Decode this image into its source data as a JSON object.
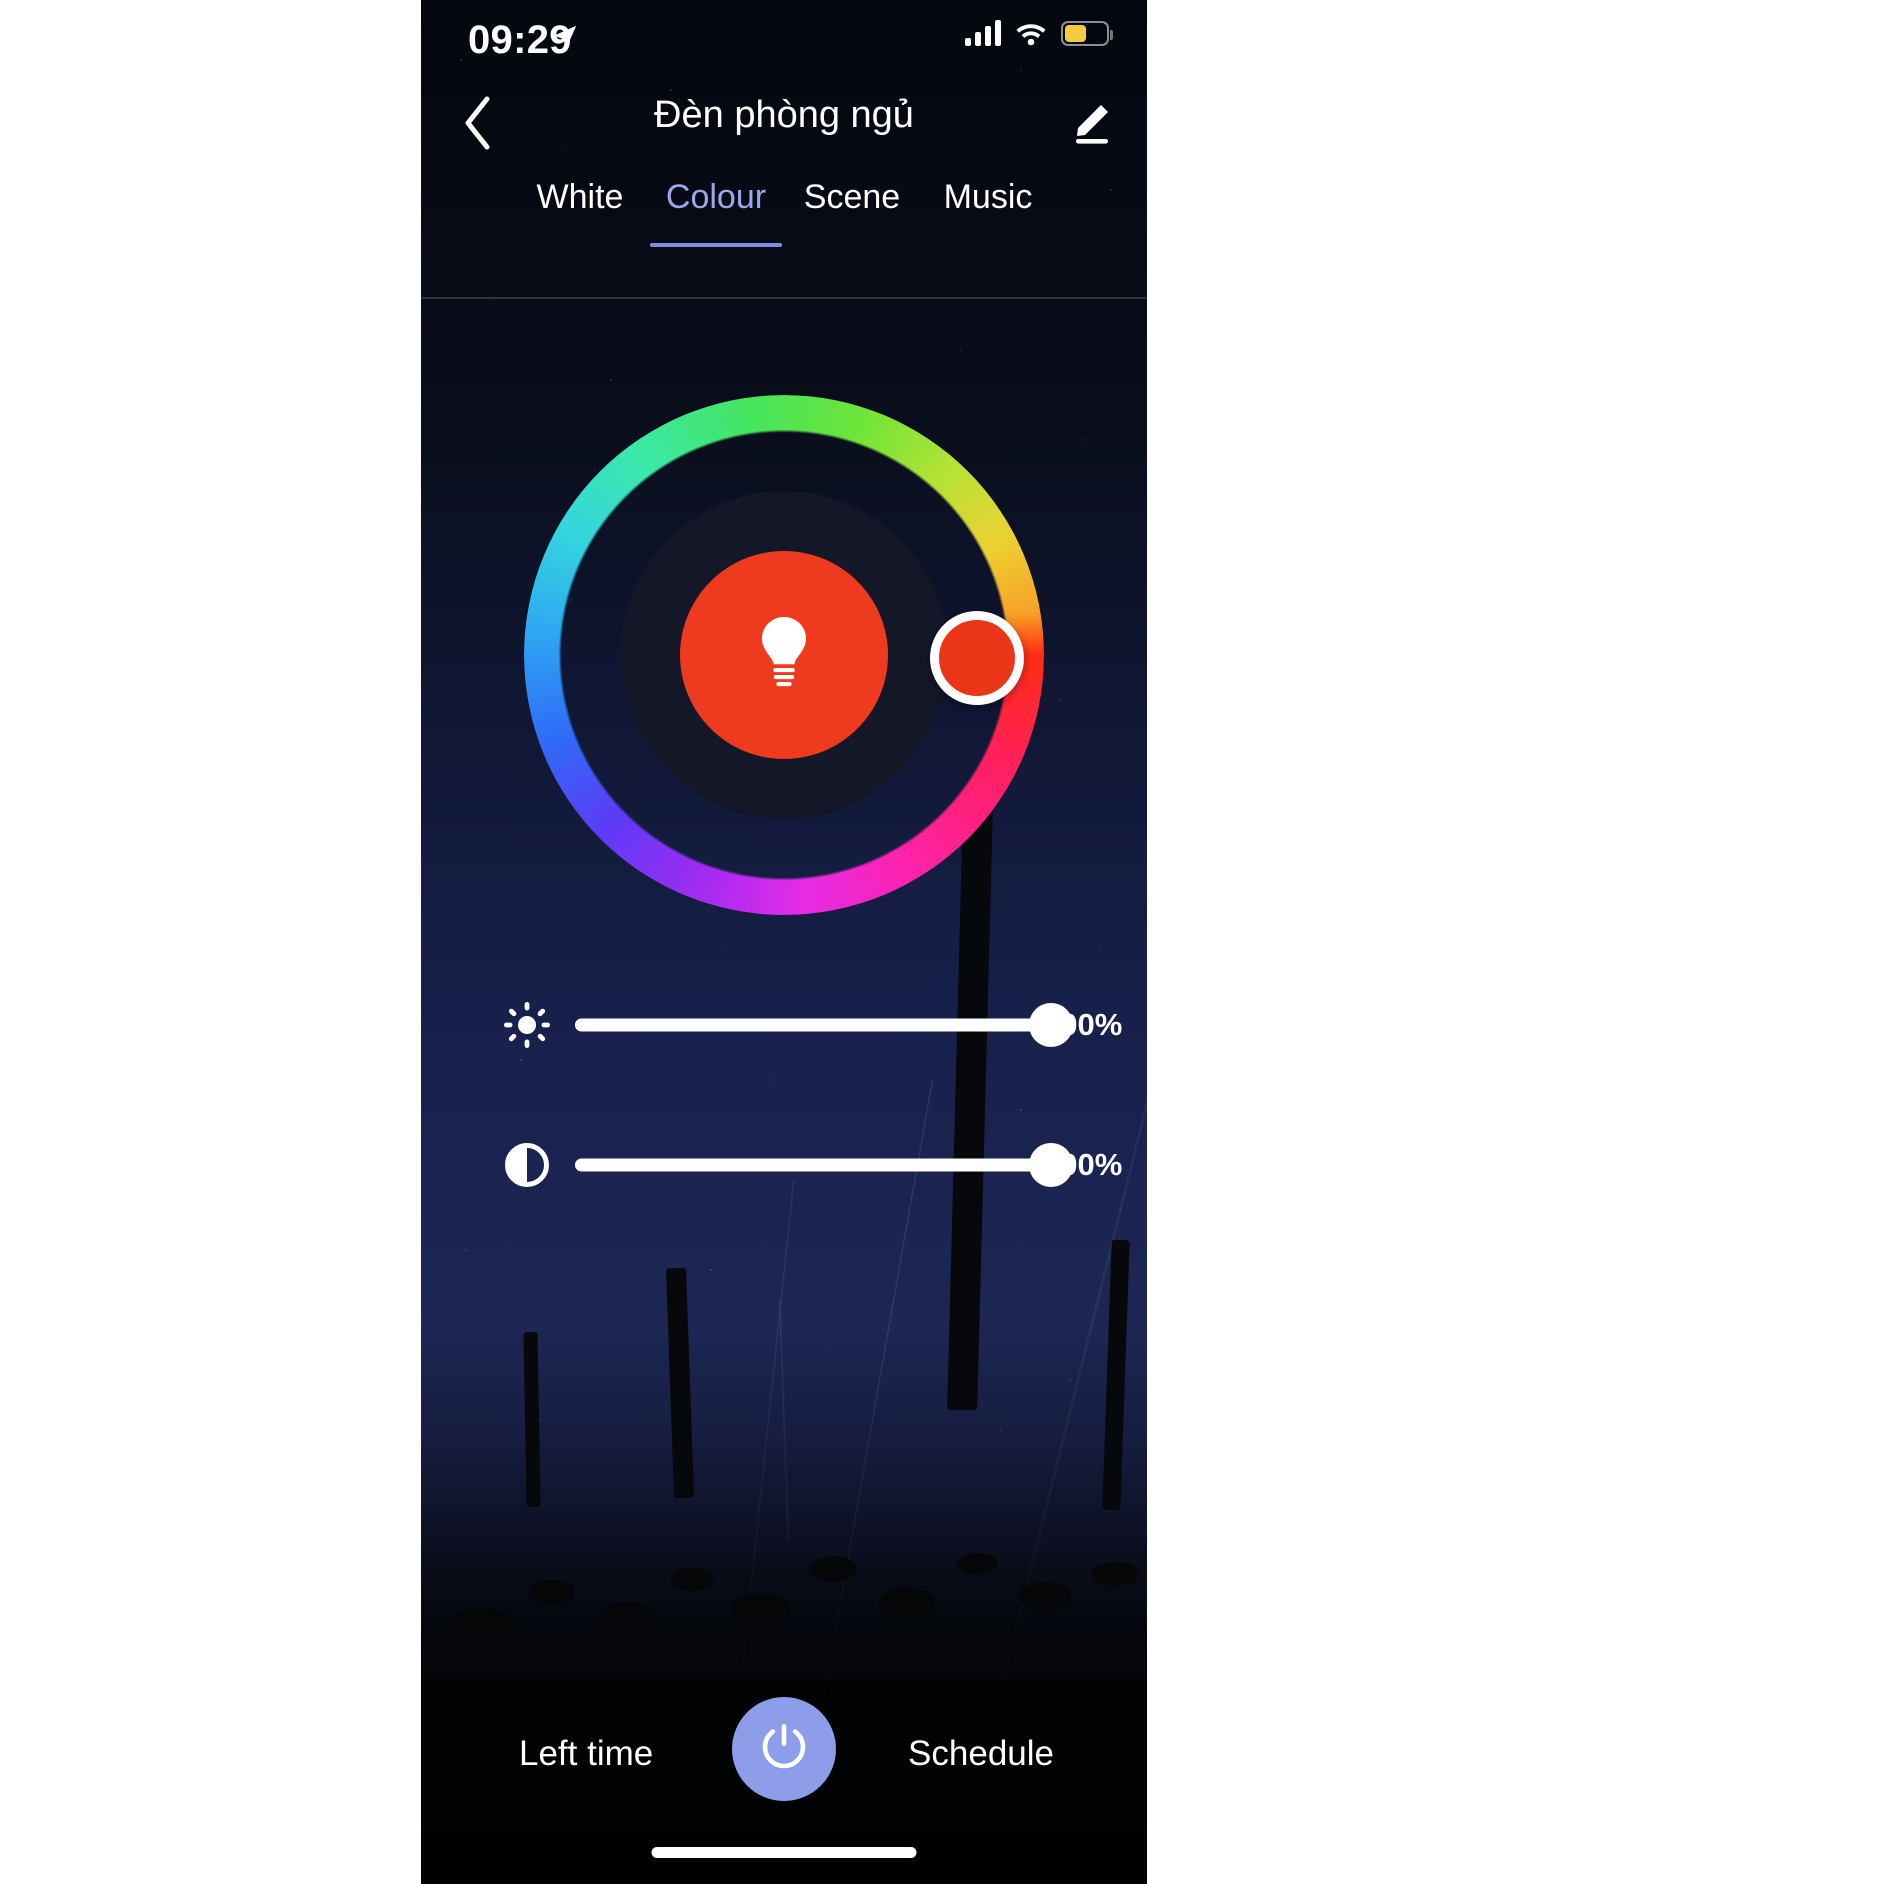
{
  "status_bar": {
    "time": "09:29",
    "location_icon": "location-arrow-icon",
    "signal_icon": "cellular-signal-icon",
    "signal_bars": 4,
    "wifi_icon": "wifi-icon",
    "battery_icon": "battery-icon",
    "battery_level_percent": 48,
    "battery_color": "#f5cc3f"
  },
  "nav": {
    "back_icon": "back-chevron-icon",
    "title": "Đèn phòng ngủ",
    "edit_icon": "edit-pencil-icon"
  },
  "tabs": {
    "active": "Colour",
    "active_color": "#9aa8ee",
    "indicator_color": "#7d8ee6",
    "items": [
      {
        "label": "White",
        "active": false
      },
      {
        "label": "Colour",
        "active": true
      },
      {
        "label": "Scene",
        "active": false
      },
      {
        "label": "Music",
        "active": false
      }
    ]
  },
  "colour_wheel": {
    "name": "colour-picker-wheel",
    "center_icon": "lightbulb-icon",
    "selected_color": "#ee3a1e",
    "handle_color": "#ea3617",
    "handle_ring_color": "#ffffff",
    "handle_angle_degrees": 0,
    "inner_disc_color": "#131728"
  },
  "sliders": [
    {
      "name": "brightness-slider",
      "icon": "brightness-sun-icon",
      "value": 100,
      "value_label": "100%",
      "min": 0,
      "max": 100
    },
    {
      "name": "saturation-slider",
      "icon": "saturation-contrast-icon",
      "value": 100,
      "value_label": "100%",
      "min": 0,
      "max": 100
    }
  ],
  "bottom_bar": {
    "left_label": "Left time",
    "right_label": "Schedule",
    "power_icon": "power-icon",
    "power_button_color": "#8e9de9",
    "home_indicator": "home-indicator-bar"
  }
}
